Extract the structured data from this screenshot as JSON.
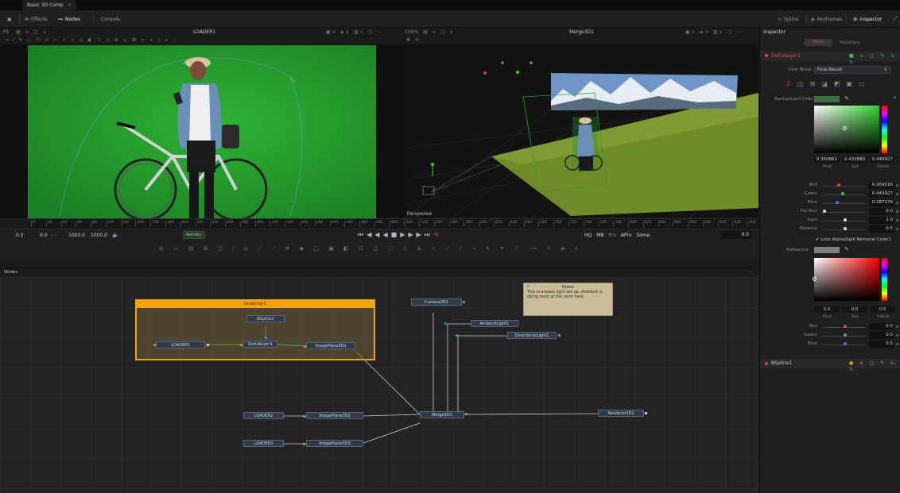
{
  "window": {
    "tab_title": "Basic 3D Comp"
  },
  "toolbar": {
    "effects_label": "Effects",
    "nodes_label": "Nodes",
    "console_label": "Console",
    "spline_label": "Spline",
    "keyframes_label": "Keyframes",
    "inspector_label": "Inspector"
  },
  "viewer_left": {
    "zoom": "Fit",
    "title": "LOADER1"
  },
  "viewer_right": {
    "zoom": "100%",
    "title": "Merge3D1",
    "overlay_label": "Perspective"
  },
  "ruler": {
    "ticks": [
      "0",
      "20",
      "40",
      "60",
      "80",
      "100",
      "120",
      "140",
      "160",
      "180",
      "200",
      "220",
      "240",
      "260",
      "280",
      "300",
      "320",
      "340",
      "360",
      "380",
      "400",
      "420",
      "440",
      "460",
      "480",
      "500",
      "520",
      "540",
      "560",
      "580",
      "600",
      "620",
      "640",
      "660",
      "680",
      "700",
      "720",
      "740",
      "760",
      "780",
      "800",
      "820",
      "840",
      "860",
      "880",
      "900",
      "920",
      "940",
      "960"
    ]
  },
  "transport": {
    "start": "0.0",
    "current": "0.0",
    "end_a": "1000.0",
    "end_b": "1000.0",
    "render_label": "Render",
    "hq": "HQ",
    "mb": "MB",
    "prx": "Prx",
    "aprx": "APrx",
    "some": "Some",
    "frame_readout": "0.0"
  },
  "nodes_panel": {
    "header": "Nodes",
    "underlay_title": "Underlay1",
    "note_title": "Note1",
    "note_body": "This is a basic light set up.  Ambient is doing most of the work here.",
    "nodes": {
      "loader1": "LOADER1",
      "bspline1": "BSpline1",
      "deltakeyer1": "DeltaKeyer1",
      "imageplane3d1": "ImagePlane3D1",
      "camera3d1": "Camera3D1",
      "ambientlight1": "AmbientLight1",
      "directionallight1": "DirectionalLight1",
      "merge3d1": "Merge3D1",
      "renderer3d1": "Renderer3D1",
      "loader2": "LOADER2",
      "imageplane3d2": "ImagePlane3D2",
      "loader3": "LOADER3",
      "imageplane3d3": "ImagePlane3D3"
    }
  },
  "inspector": {
    "title": "Inspector",
    "tab_tools": "Tools",
    "tab_modifiers": "Modifiers",
    "tool_name": "DeltaKeyer1",
    "view_mode_label": "View Mode",
    "view_mode_value": "Final Result",
    "background_color_label": "Background Color",
    "picker1": {
      "hue": "0.350861",
      "sat": "0.432880",
      "val": "0.449927",
      "hue_label": "Hue",
      "sat_label": "Sat",
      "val_label": "Value"
    },
    "sliders1": [
      {
        "label": "Red",
        "value": "0.269016",
        "color": "#d84a4a",
        "pos": 0.35
      },
      {
        "label": "Green",
        "value": "0.449927",
        "color": "#4ac04a",
        "pos": 0.45
      },
      {
        "label": "Blue",
        "value": "0.287174",
        "color": "#4a7ad8",
        "pos": 0.33
      },
      {
        "label": "Pre Blur",
        "value": "0.0",
        "color": "#dddddd",
        "pos": 0.02
      },
      {
        "label": "Gain",
        "value": "1.0",
        "color": "#dddddd",
        "pos": 0.5
      },
      {
        "label": "Balance",
        "value": "0.5",
        "color": "#dddddd",
        "pos": 0.5
      }
    ],
    "lock_label": "Lock Alpha/Spill Removal Color1",
    "reference_label": "Reference",
    "picker2": {
      "hue": "0.0",
      "sat": "0.0",
      "val": "0.5",
      "hue_label": "Hue",
      "sat_label": "Sat",
      "val_label": "Value"
    },
    "sliders2": [
      {
        "label": "Red",
        "value": "0.5",
        "color": "#d84a4a",
        "pos": 0.5
      },
      {
        "label": "Green",
        "value": "0.5",
        "color": "#4ac04a",
        "pos": 0.5
      },
      {
        "label": "Blue",
        "value": "0.5",
        "color": "#4a7ad8",
        "pos": 0.5
      }
    ],
    "tool2_name": "BSpline1"
  },
  "colors": {
    "accent_red": "#e0483c",
    "underlay_orange": "#f2a20c",
    "greenscreen": "#249b2c",
    "note_bg": "#c9bc98"
  },
  "icons": [
    "effects-icon",
    "nodes-icon",
    "spline-icon",
    "keyframes-icon",
    "inspector-icon",
    "speaker-icon",
    "play-icon",
    "stop-icon",
    "skip-start-icon",
    "skip-end-icon",
    "loop-icon",
    "eyedropper-icon"
  ]
}
